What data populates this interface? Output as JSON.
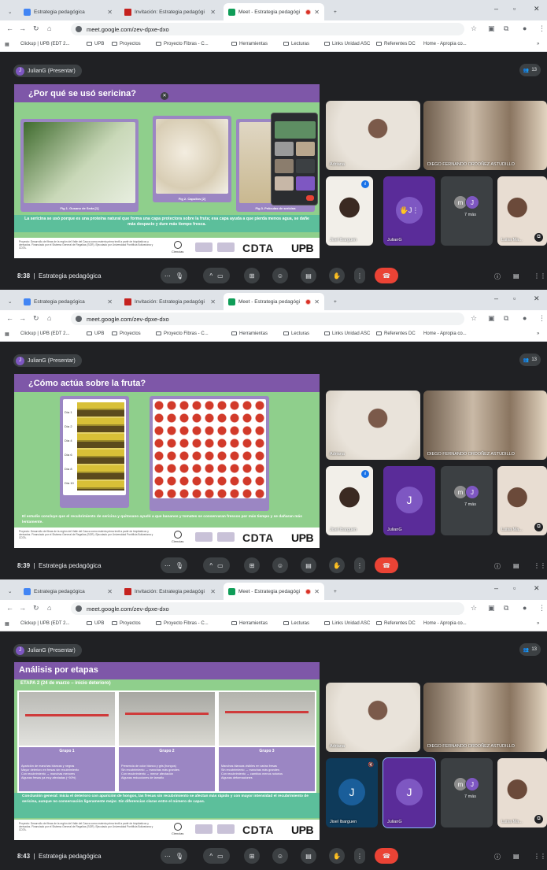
{
  "browser": {
    "tabs": [
      {
        "label": "Estrategia pedagógica",
        "color": "#4285f4"
      },
      {
        "label": "Invitación: Estrategia pedagógi",
        "color": "#c5221f"
      },
      {
        "label": "Meet - Estrategia pedagógi",
        "color": "#0f9d58"
      }
    ],
    "new_tab": "+",
    "url": "meet.google.com/zev-dpxe-dxo",
    "bookmarks": [
      "Clickup | UPB (EDT 2...",
      "UPB",
      "Proyectos",
      "Proyecto Fibras - C...",
      "Herramientas",
      "Lecturas",
      "Links Unidad ASC",
      "Referentes DC",
      "Home - Apropia co..."
    ]
  },
  "meet": {
    "presenter_label": "JulianG (Presentar)",
    "presenter_initial": "J",
    "people_count": "13",
    "meeting_title": "Estrategia pedagógica",
    "more_label": "7 más"
  },
  "frames": [
    {
      "time": "8:38",
      "slide": {
        "title": "¿Por qué se usó sericina?",
        "subtitle": "",
        "captions": [
          "Fig 1. Gusano de Seda [1]",
          "Fig 2. Capullos [2]",
          "Fig 3. Películas de sericina"
        ],
        "body": "La sericina se usó porque es una proteína natural que forma una capa protectora sobre la fruta; esa capa ayuda a que pierda menos agua, se dañe más despacio y dure más tiempo fresca."
      },
      "tiles": [
        "Adriana",
        "DIEGO FERNANDO ORDOÑEZ ASTUDILLO",
        "Jisel Ibarguen",
        "JulianG",
        "Luisa Ma..."
      ]
    },
    {
      "time": "8:39",
      "slide": {
        "title": "¿Cómo actúa sobre la fruta?",
        "subtitle": "",
        "days": [
          "Día 1",
          "Día 2",
          "Día 4",
          "Día 6",
          "Día 8",
          "Día 10"
        ],
        "body": "El estudio concluye que el recubrimiento de sericina y quitosano ayudó a que bananos y tomates se conservaran frescos por más tiempo y se dañaran más lentamente."
      },
      "tiles": [
        "Adriana",
        "DIEGO FERNANDO ORDOÑEZ ASTUDILLO",
        "Jisel Ibarguen",
        "JulianG",
        "Luisa Ma..."
      ]
    },
    {
      "time": "8:43",
      "slide": {
        "title": "Análisis por etapas",
        "subtitle": "ETAPA 2 (24 de marzo – inicio deterioro)",
        "groups": [
          {
            "name": "Grupo 1",
            "bullets": [
              "Aparición de manchas blancas y negras",
              "Mayor deterioro en fresas sin recubrimiento",
              "Con recubrimiento → manchas menores",
              "Algunas fresas ya muy afectadas (~50%)"
            ]
          },
          {
            "name": "Grupo 2",
            "bullets": [
              "Presencia de color blanco y gris (hongos)",
              "Sin recubrimiento → manchas más grandes",
              "Con recubrimiento → menor afectación",
              "Algunas reducciones de tamaño"
            ]
          },
          {
            "name": "Grupo 3",
            "bullets": [
              "Manchas blancas visibles en varias fresas",
              "Sin recubrimiento → manchas más grandes",
              "Con recubrimiento → cambios menos notorios",
              "Algunas deformaciones"
            ]
          }
        ],
        "body": "Conclusión general: Inicia el deterioro con aparición de hongos, las fresas sin recubrimiento se afectan más rápido y con mayor intensidad el recubrimiento de sericina, aunque no conservación ligeramente mejor. Sin diferencias claras entre el número de capas."
      },
      "tiles": [
        "Adriana",
        "DIEGO FERNANDO ORDOÑEZ ASTUDILLO",
        "Jisel Ibarguen",
        "JulianG",
        "Luisa Ma..."
      ]
    }
  ],
  "footer": {
    "text": "Proyecto: Desarrollo de fibras de la región del Valle del Cauca como materia prima textil a partir de bioplásticos y derivados. Financiado por el Sistema General de Regalías (SGR). Ejecutado por Universidad Pontificia Bolivariana y CDTA.",
    "ciencias": "Ciencias",
    "cdta": "CDTA",
    "upb": "UPB"
  },
  "colors": {
    "slide_green": "#8fcf8c",
    "slide_purple": "#7e57a8",
    "slide_teal": "#5cbf9b",
    "meet_bg": "#202124",
    "hangup": "#ea4335"
  }
}
